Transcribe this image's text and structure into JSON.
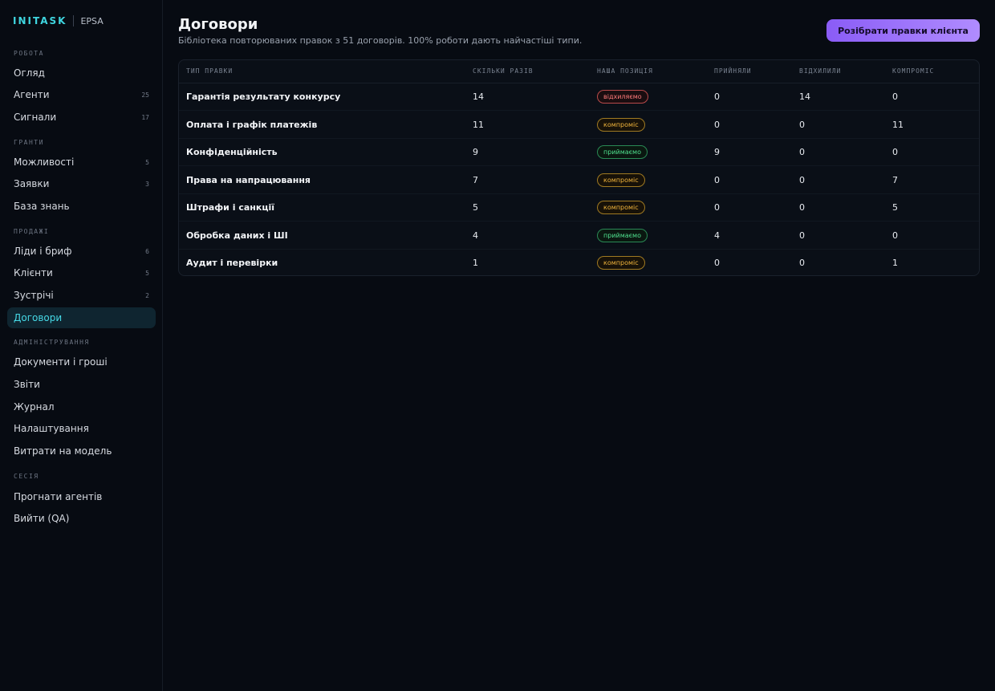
{
  "brand": {
    "logo": "INITASK",
    "sub": "EPSA"
  },
  "sidebar": {
    "sections": [
      {
        "title": "РОБОТА",
        "items": [
          {
            "label": "Огляд",
            "count": ""
          },
          {
            "label": "Агенти",
            "count": "25"
          },
          {
            "label": "Сигнали",
            "count": "17"
          }
        ]
      },
      {
        "title": "ГРАНТИ",
        "items": [
          {
            "label": "Можливості",
            "count": "5"
          },
          {
            "label": "Заявки",
            "count": "3"
          },
          {
            "label": "База знань",
            "count": ""
          }
        ]
      },
      {
        "title": "ПРОДАЖІ",
        "items": [
          {
            "label": "Ліди і бриф",
            "count": "6"
          },
          {
            "label": "Клієнти",
            "count": "5"
          },
          {
            "label": "Зустрічі",
            "count": "2"
          },
          {
            "label": "Договори",
            "count": "",
            "active": true
          }
        ]
      },
      {
        "title": "АДМІНІСТРУВАННЯ",
        "items": [
          {
            "label": "Документи і гроші",
            "count": ""
          },
          {
            "label": "Звіти",
            "count": ""
          },
          {
            "label": "Журнал",
            "count": ""
          },
          {
            "label": "Налаштування",
            "count": ""
          },
          {
            "label": "Витрати на модель",
            "count": ""
          }
        ]
      },
      {
        "title": "СЕСІЯ",
        "items": [
          {
            "label": "Прогнати агентів",
            "count": ""
          },
          {
            "label": "Вийти (QA)",
            "count": ""
          }
        ]
      }
    ]
  },
  "main": {
    "title": "Договори",
    "subtitle": "Бібліотека повторюваних правок з 51 договорів. 100% роботи дають найчастіші типи.",
    "primary_button": "Розібрати правки клієнта",
    "table": {
      "headers": [
        "ТИП ПРАВКИ",
        "СКІЛЬКИ РАЗІВ",
        "НАША ПОЗИЦІЯ",
        "ПРИЙНЯЛИ",
        "ВІДХИЛИЛИ",
        "КОМПРОМІС"
      ],
      "rows": [
        {
          "type": "Гарантія результату конкурсу",
          "count": "14",
          "position": "відхиляємо",
          "status": "reject",
          "accepted": "0",
          "rejected": "14",
          "compromise": "0"
        },
        {
          "type": "Оплата і графік платежів",
          "count": "11",
          "position": "компроміс",
          "status": "compromise",
          "accepted": "0",
          "rejected": "0",
          "compromise": "11"
        },
        {
          "type": "Конфіденційність",
          "count": "9",
          "position": "приймаємо",
          "status": "accept",
          "accepted": "9",
          "rejected": "0",
          "compromise": "0"
        },
        {
          "type": "Права на напрацювання",
          "count": "7",
          "position": "компроміс",
          "status": "compromise",
          "accepted": "0",
          "rejected": "0",
          "compromise": "7"
        },
        {
          "type": "Штрафи і санкції",
          "count": "5",
          "position": "компроміс",
          "status": "compromise",
          "accepted": "0",
          "rejected": "0",
          "compromise": "5"
        },
        {
          "type": "Обробка даних і ШІ",
          "count": "4",
          "position": "приймаємо",
          "status": "accept",
          "accepted": "4",
          "rejected": "0",
          "compromise": "0"
        },
        {
          "type": "Аудит і перевірки",
          "count": "1",
          "position": "компроміс",
          "status": "compromise",
          "accepted": "0",
          "rejected": "0",
          "compromise": "1"
        }
      ]
    }
  },
  "colors": {
    "accent": "#46d9e6",
    "button": "#8a5cf6",
    "reject": "#ff7a7a",
    "compromise": "#f0b43c",
    "accept": "#4fe08e"
  }
}
